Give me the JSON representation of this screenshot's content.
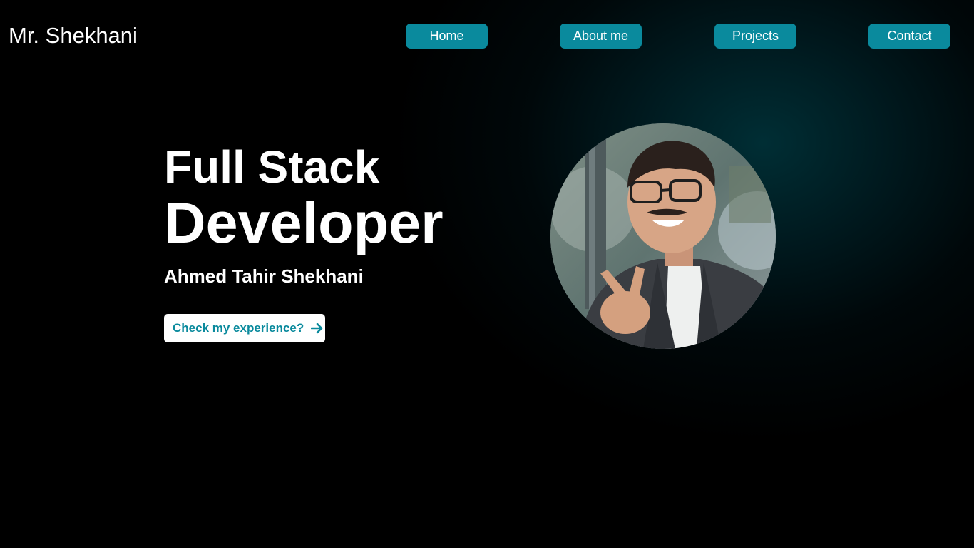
{
  "header": {
    "logo": "Mr. Shekhani",
    "nav": {
      "home": "Home",
      "about": "About me",
      "projects": "Projects",
      "contact": "Contact"
    }
  },
  "hero": {
    "title_line1": "Full Stack",
    "title_line2": "Developer",
    "name": "Ahmed Tahir Shekhani",
    "cta_label": "Check my experience?",
    "cta_icon": "arrow-right-icon",
    "avatar_alt": "profile-photo"
  },
  "colors": {
    "accent": "#0a8a9d",
    "background": "#000000",
    "glow": "#005460",
    "text": "#ffffff"
  }
}
